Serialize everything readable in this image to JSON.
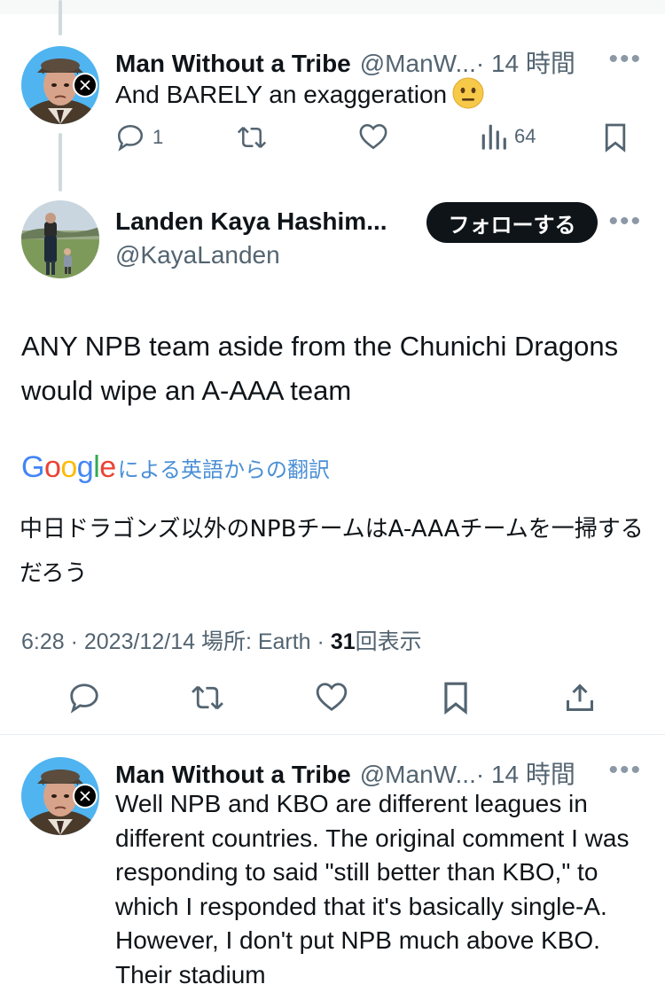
{
  "reply1": {
    "display_name": "Man Without a Tribe",
    "handle": "@ManW...",
    "time": "· 14 時間",
    "text": "And BARELY an exaggeration",
    "emoji": "neutral-face-emoji",
    "replies": "1",
    "views": "64"
  },
  "main_tweet": {
    "display_name": "Landen Kaya Hashim...",
    "handle": "@KayaLanden",
    "follow_label": "フォローする",
    "text": "ANY NPB team aside from the Chunichi Dragons would wipe an A-AAA team",
    "translation_label": "による英語からの翻訳",
    "translated_text": "中日ドラゴンズ以外のNPBチームはA-AAAチームを一掃するだろう",
    "meta_prefix": "6:28 · 2023/12/14 場所: Earth · ",
    "view_count": "31",
    "view_suffix": "回表示"
  },
  "reply2": {
    "display_name": "Man Without a Tribe",
    "handle": "@ManW...",
    "time": "· 14 時間",
    "text": "Well NPB and KBO are different leagues in different countries. The original comment I was responding to said \"still better than KBO,\" to which I responded that it's basically single-A. However, I don't put NPB much above KBO. Their stadium"
  },
  "colors": {
    "text": "#0f1419",
    "secondary": "#536471",
    "link_blue": "#4a8fd6",
    "follow_bg": "#0f1419",
    "divider": "#e6ecf0"
  },
  "icons": [
    "reply-icon",
    "retweet-icon",
    "like-icon",
    "views-icon",
    "bookmark-icon",
    "share-icon",
    "more-icon",
    "x-badge-icon"
  ]
}
